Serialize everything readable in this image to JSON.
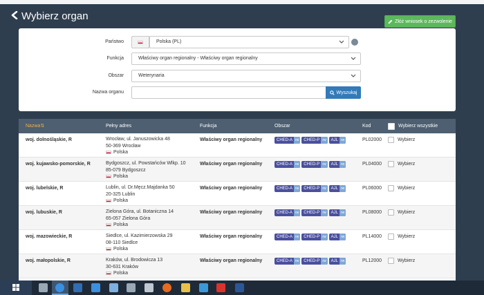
{
  "header": {
    "title": "Wybierz organ",
    "apply_label": "Złóż wniosek o zezwolenie"
  },
  "filters": {
    "panstwo": {
      "label": "Państwo",
      "value": "Polska (PL)"
    },
    "funkcja": {
      "label": "Funkcja",
      "value": "Właściwy organ regionalny - Właściwy organ regionalny"
    },
    "obszar": {
      "label": "Obszar",
      "value": "Weterynaria"
    },
    "nazwa": {
      "label": "Nazwa organu",
      "value": "",
      "placeholder": ""
    },
    "search_label": "Wyszukaj"
  },
  "table": {
    "headers": {
      "name": "Nazwa",
      "address": "Pełny adres",
      "function": "Funkcja",
      "area": "Obszar",
      "code": "Kod",
      "select_all": "Wybierz wszystkie"
    },
    "rows": [
      {
        "name": "woj. dolnośląskie, R",
        "addr1": "Wrocław, ul. Januszowicka 48",
        "addr2": "50-369 Wrocław",
        "country": "Polska",
        "function": "Właściwy organ regionalny",
        "tags": [
          "CHED-A",
          "CHED-P",
          "AJL"
        ],
        "rw": "rw",
        "code": "PL02000",
        "select": "Wybierz"
      },
      {
        "name": "woj. kujawsko-pomorskie, R",
        "addr1": "Bydgoszcz, ul. Powstańców Wlkp. 10",
        "addr2": "85-079 Bydgoszcz",
        "country": "Polska",
        "function": "Właściwy organ regionalny",
        "tags": [
          "CHED-A",
          "CHED-P",
          "AJL"
        ],
        "rw": "rw",
        "code": "PL04000",
        "select": "Wybierz"
      },
      {
        "name": "woj. lubelskie, R",
        "addr1": "Lublin, ul. Dr.Męcz.Majdanka 50",
        "addr2": "20-325 Lublin",
        "country": "Polska",
        "function": "Właściwy organ regionalny",
        "tags": [
          "CHED-A",
          "CHED-P",
          "AJL"
        ],
        "rw": "rw",
        "code": "PL06000",
        "select": "Wybierz"
      },
      {
        "name": "woj. lubuskie, R",
        "addr1": "Zielona Góra, ul. Botaniczna 14",
        "addr2": "65-057 Zielona Góra",
        "country": "Polska",
        "function": "Właściwy organ regionalny",
        "tags": [
          "CHED-A",
          "CHED-P",
          "AJL"
        ],
        "rw": "rw",
        "code": "PL08000",
        "select": "Wybierz"
      },
      {
        "name": "woj. mazowieckie, R",
        "addr1": "Siedlce, ul. Kazimierzowska 29",
        "addr2": "08-110 Siedlce",
        "country": "Polska",
        "function": "Właściwy organ regionalny",
        "tags": [
          "CHED-A",
          "CHED-P",
          "AJL"
        ],
        "rw": "rw",
        "code": "PL14000",
        "select": "Wybierz"
      },
      {
        "name": "woj. małopolskie, R",
        "addr1": "Kraków, ul. Brodowicza 13",
        "addr2": "30-631 Kraków",
        "country": "Polska",
        "function": "Właściwy organ regionalny",
        "tags": [
          "CHED-A",
          "CHED-P",
          "AJL"
        ],
        "rw": "rw",
        "code": "PL12000",
        "select": "Wybierz"
      }
    ]
  },
  "colors": {
    "background": "#2f3e4e",
    "primary": "#337ab7",
    "success": "#5cb85c",
    "tag": "#4a4f9e",
    "tag_rw": "#7fa7d6",
    "sort_accent": "#f0ad4e"
  },
  "taskbar": {
    "icons": [
      "task-view-icon",
      "edge-icon",
      "outlook-icon",
      "ie-icon",
      "email-icon",
      "network-icon",
      "remote-desktop-icon",
      "firefox-icon",
      "folder-icon",
      "mail-app-icon",
      "pdf-icon",
      "word-icon"
    ]
  }
}
